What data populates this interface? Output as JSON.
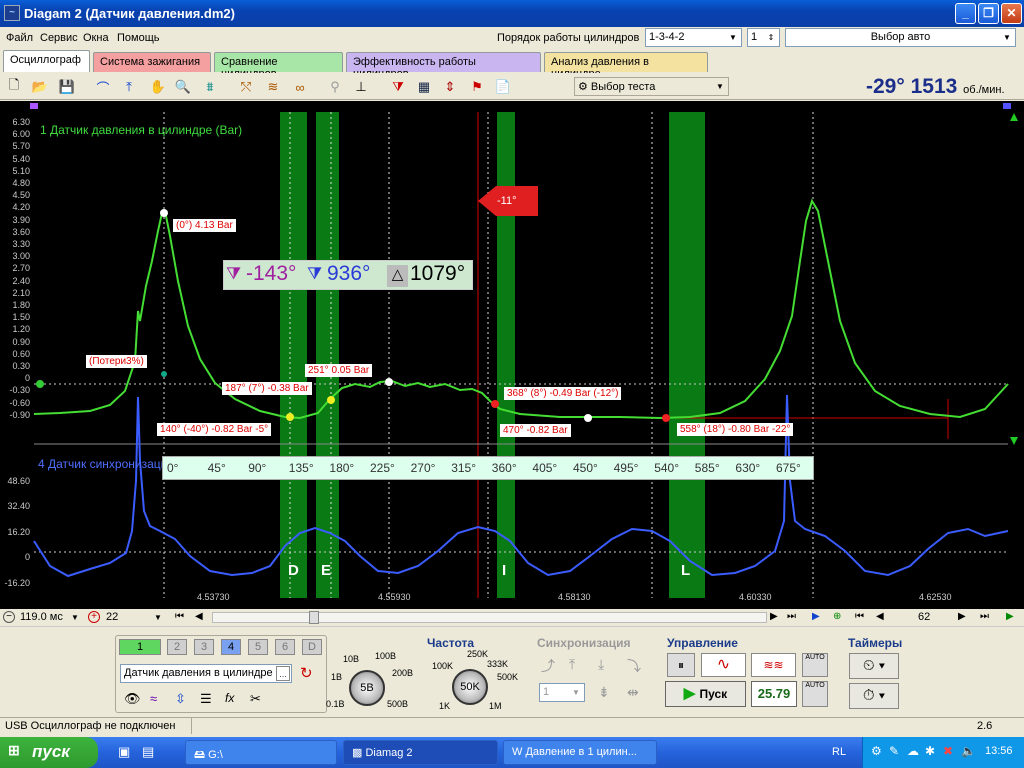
{
  "window": {
    "title": "Diagam 2 (Датчик давления.dm2)"
  },
  "menu": {
    "items": [
      "Файл",
      "Сервис",
      "Окна",
      "Помощь"
    ],
    "cyl_order_label": "Порядок работы цилиндров",
    "cyl_order_value": "1-3-4-2",
    "cyl_num": "1",
    "car_select": "Выбор авто"
  },
  "tabs": [
    {
      "label": "Осциллограф",
      "color": "#ffffff"
    },
    {
      "label": "Система зажигания",
      "color": "#f4a0a0"
    },
    {
      "label": "Сравнение цилиндров",
      "color": "#a8e6a8"
    },
    {
      "label": "Эффективность работы цилиндров",
      "color": "#c9b6f0"
    },
    {
      "label": "Анализ давления в цилиндре",
      "color": "#f4e2a0"
    }
  ],
  "toolbar": {
    "test_select": "Выбор теста",
    "readout_angle": "-29°",
    "readout_rpm": "1513",
    "readout_unit": "об./мин."
  },
  "plot": {
    "ch1_title": "1 Датчик давления в цилиндре (Bar)",
    "ch4_title": "4 Датчик синхронизации",
    "y_ticks": [
      "6.30",
      "6.00",
      "5.70",
      "5.40",
      "5.10",
      "4.80",
      "4.50",
      "4.20",
      "3.90",
      "3.60",
      "3.30",
      "3.00",
      "2.70",
      "2.40",
      "2.10",
      "1.80",
      "1.50",
      "1.20",
      "0.90",
      "0.60",
      "0.30",
      "0",
      "-0.30",
      "-0.60",
      "-0.90"
    ],
    "y4_ticks": [
      "48.60",
      "32.40",
      "16.20",
      "0",
      "-16.20"
    ],
    "x_ticks": [
      "4.53730",
      "4.55930",
      "4.58130",
      "4.60330",
      "4.62530"
    ],
    "marker": "-11°",
    "labels": {
      "peak": "(0°) 4.13 Bar",
      "loss": "(Потери3%)",
      "l140": "140° (-40°) -0.82 Bar -5°",
      "l187": "187° (7°) -0.38 Bar",
      "l251": "251° 0.05 Bar",
      "l368": "368° (8°) -0.49 Bar (-12°)",
      "l470": "470° -0.82 Bar",
      "l558": "558° (18°) -0.80 Bar -22°"
    },
    "cursor_a": "-143°",
    "cursor_b": "936°",
    "cursor_delta": "1079°",
    "degrees": [
      "0°",
      "45°",
      "90°",
      "135°",
      "180°",
      "225°",
      "270°",
      "315°",
      "360°",
      "405°",
      "450°",
      "495°",
      "540°",
      "585°",
      "630°",
      "675°"
    ],
    "zones": [
      "D",
      "E",
      "I",
      "L"
    ]
  },
  "scroll": {
    "time": "119.0 мс",
    "zoom": "22",
    "page": "62"
  },
  "channels": [
    "1",
    "2",
    "3",
    "4",
    "5",
    "6",
    "D"
  ],
  "channel_sensor": "Датчик давления в цилиндре",
  "range": {
    "labels": [
      "10В",
      "100В",
      "1В",
      "200В",
      "0.1В",
      "500В"
    ],
    "value": "5В"
  },
  "freq": {
    "title": "Частота",
    "labels": [
      "250K",
      "100K",
      "333K",
      "500K",
      "1K",
      "1M"
    ],
    "value": "50K"
  },
  "sync": {
    "title": "Синхронизация",
    "value": "1"
  },
  "control": {
    "title": "Управление",
    "start": "Пуск",
    "value": "25.79"
  },
  "timers": {
    "title": "Таймеры"
  },
  "status": {
    "text": "USB Осциллограф не подключен",
    "right": "2.6"
  },
  "taskbar": {
    "start": "пуск",
    "tasks": [
      "G:\\",
      "Diamag 2",
      "Давление в 1 цилин..."
    ],
    "lang": "RL",
    "clock": "13:56"
  }
}
